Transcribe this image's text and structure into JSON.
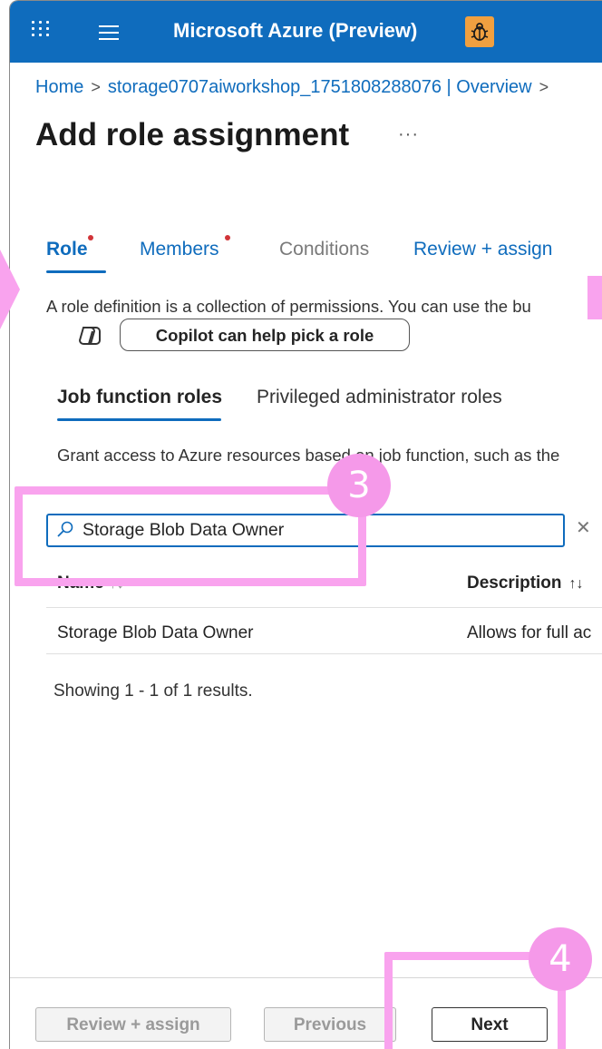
{
  "header": {
    "app_title": "Microsoft Azure (Preview)",
    "waffle_icon": "waffle-icon",
    "menu_icon": "hamburger-menu-icon",
    "feedback_icon": "bug-icon"
  },
  "breadcrumb": {
    "items": [
      "Home",
      "storage0707aiworkshop_1751808288076 | Overview"
    ],
    "separator": ">"
  },
  "page": {
    "title": "Add role assignment",
    "more": "···"
  },
  "tabs": [
    {
      "label": "Role",
      "state": "active",
      "required": true
    },
    {
      "label": "Members",
      "state": "link",
      "required": true
    },
    {
      "label": "Conditions",
      "state": "disabled",
      "required": false
    },
    {
      "label": "Review + assign",
      "state": "link",
      "required": false
    }
  ],
  "role_section": {
    "description": "A role definition is a collection of permissions. You can use the bu",
    "copilot_button": "Copilot can help pick a role"
  },
  "subtabs": [
    {
      "label": "Job function roles",
      "active": true
    },
    {
      "label": "Privileged administrator roles",
      "active": false
    }
  ],
  "grant_text": "Grant access to Azure resources based on job function, such as the",
  "search": {
    "value": "Storage Blob Data Owner",
    "placeholder": ""
  },
  "table": {
    "columns": [
      "Name",
      "Description"
    ],
    "rows": [
      {
        "name": "Storage Blob Data Owner",
        "description": "Allows for full ac"
      }
    ],
    "results_text": "Showing 1 - 1 of 1 results."
  },
  "footer": {
    "review_assign": "Review + assign",
    "previous": "Previous",
    "next": "Next"
  },
  "annotations": {
    "step_3": "3",
    "step_4": "4",
    "highlight_color": "#f9a3ee"
  }
}
